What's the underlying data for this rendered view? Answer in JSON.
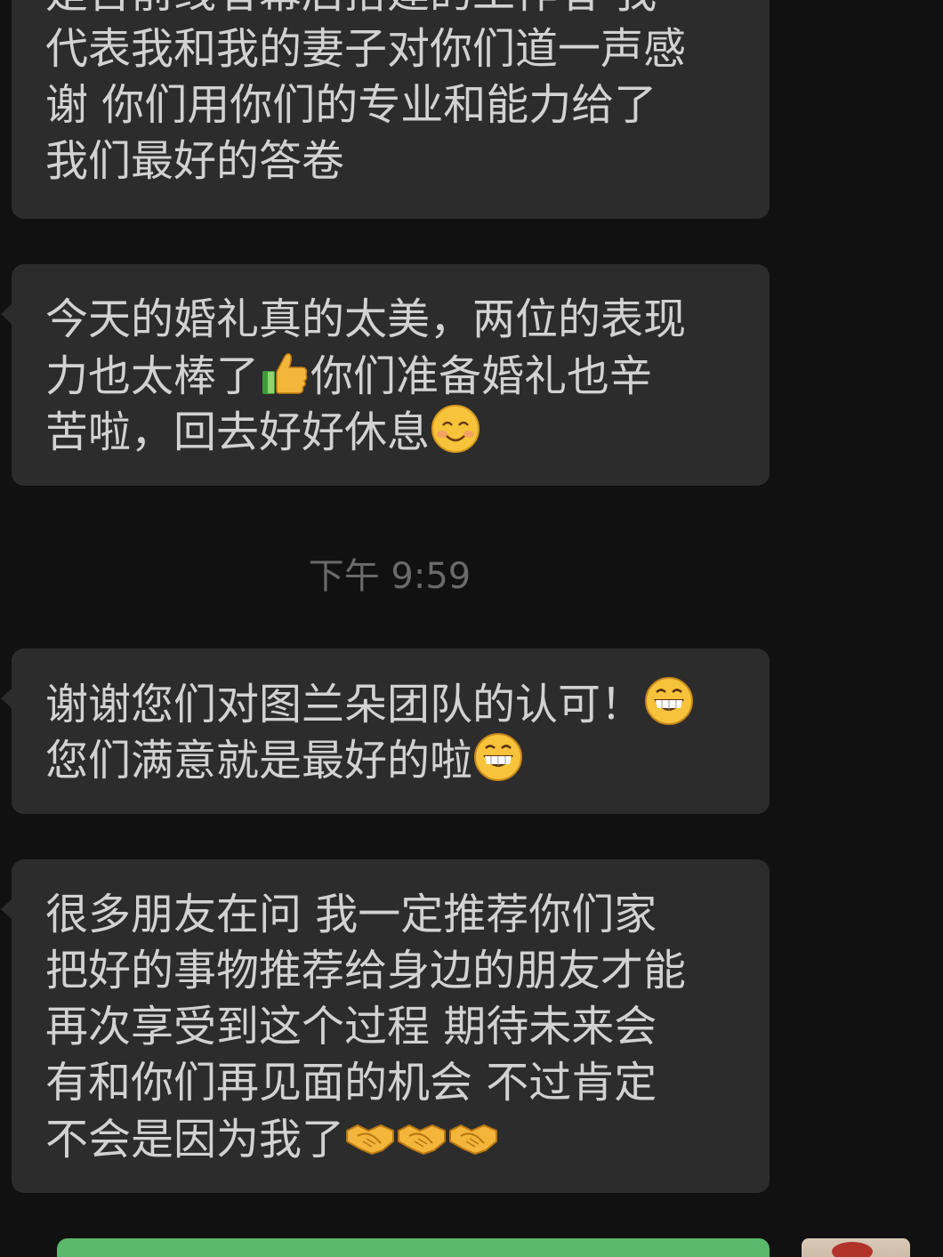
{
  "messages": [
    {
      "side": "incoming",
      "lines": [
        "是否前线者幕后搭建的工作者 我",
        "代表我和我的妻子对你们道一声感",
        "谢 你们用你们的专业和能力给了",
        "我们最好的答卷"
      ]
    },
    {
      "side": "incoming",
      "lines": [
        "今天的婚礼真的太美，两位的表现",
        "力也太棒了",
        "你们准备婚礼也辛",
        "苦啦，回去好好休息"
      ],
      "emojis": [
        "thumbs-up-icon",
        "smiling-face-icon"
      ]
    },
    {
      "side": "outgoing-timestamp",
      "time": "下午 9:59"
    },
    {
      "side": "incoming",
      "lines": [
        "谢谢您们对图兰朵团队的认可！",
        " 您们满意就是最好的啦"
      ],
      "emojis": [
        "grinning-face-icon",
        "grinning-face-icon"
      ]
    },
    {
      "side": "incoming",
      "lines": [
        "很多朋友在问 我一定推荐你们家",
        "把好的事物推荐给身边的朋友才能",
        "再次享受到这个过程 期待未来会",
        "有和你们再见面的机会 不过肯定",
        "不会是因为我了"
      ],
      "emojis": [
        "handshake-icon",
        "handshake-icon",
        "handshake-icon"
      ]
    }
  ],
  "colors": {
    "background": "#111111",
    "incoming_bubble": "#2c2c2c",
    "incoming_text": "#d2d2d2",
    "timestamp_text": "#6a6a6a",
    "outgoing_bubble": "#59b86a"
  }
}
